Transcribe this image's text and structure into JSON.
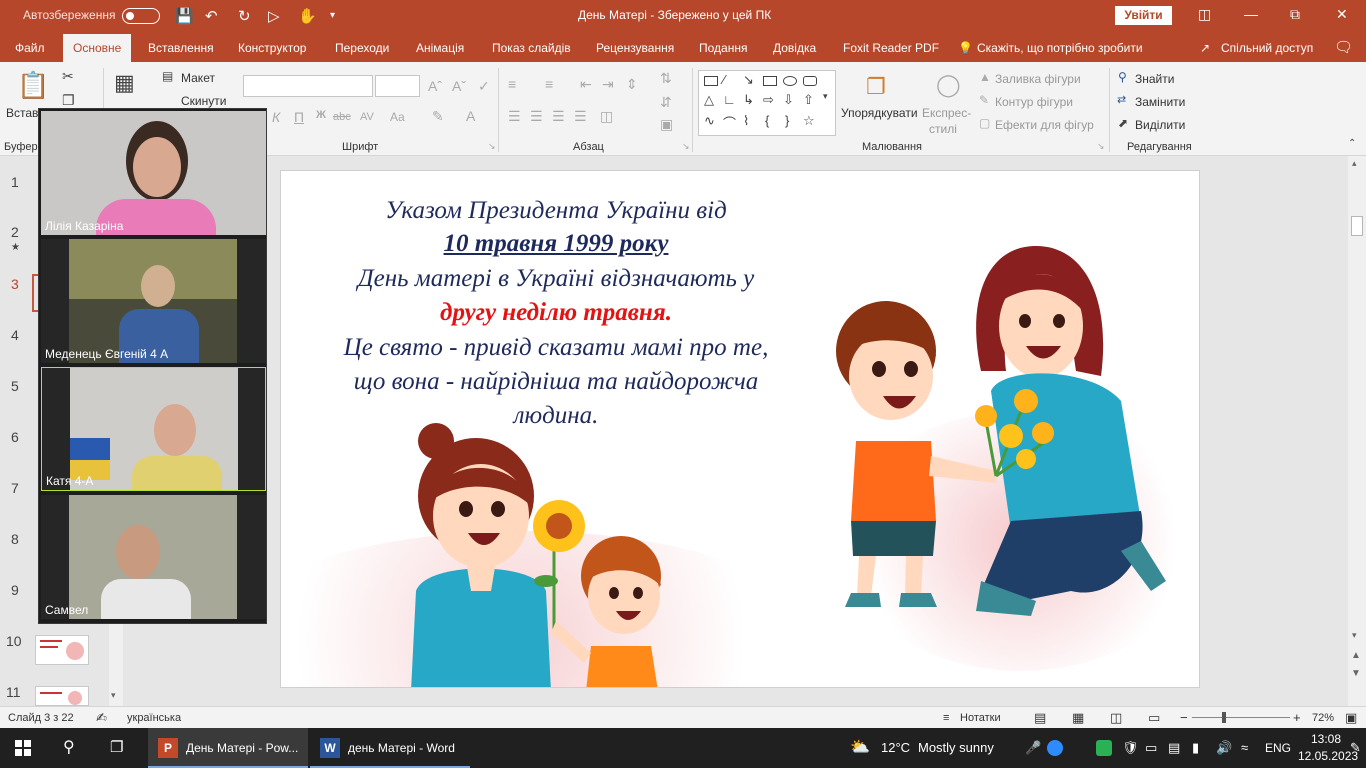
{
  "titlebar": {
    "autosave": "Автозбереження",
    "title": "День Матері  -  Збережено у цей ПК",
    "signin": "Увійти"
  },
  "menu": [
    "Файл",
    "Основне",
    "Вставлення",
    "Конструктор",
    "Переходи",
    "Анімація",
    "Показ слайдів",
    "Рецензування",
    "Подання",
    "Довідка",
    "Foxit Reader PDF"
  ],
  "tell_me": "Скажіть, що потрібно зробити",
  "share": "Спільний доступ",
  "ribbon": {
    "paste": "Встав",
    "layout": "Макет",
    "reset": "Скинути",
    "bold": "Ж",
    "italic": "К",
    "underline": "П",
    "strike": "abc",
    "spacing": "AV",
    "case": "Aa",
    "arrange": "Упорядкувати",
    "quick1": "Експрес-",
    "quick2": "стилі",
    "fill": "Заливка фігури",
    "outline": "Контур фігури",
    "effects": "Ефекти для фігур",
    "find": "Знайти",
    "replace": "Замінити",
    "select": "Виділити",
    "groups": {
      "clip": "Буфер",
      "font": "Шрифт",
      "para": "Абзац",
      "draw": "Малювання",
      "edit": "Редагування"
    }
  },
  "slide_numbers": [
    "1",
    "2",
    "3",
    "4",
    "5",
    "6",
    "7",
    "8",
    "9",
    "10",
    "11"
  ],
  "slide_star": "★",
  "slide": {
    "line1": "Указом Президента України від",
    "line2": "10 травня 1999 року",
    "line3": "День матері в Україні відзначають у",
    "line4": "другу неділю травня.",
    "line5": "Це свято - привід сказати мамі про те,",
    "line6": "що вона - найрідніша та найдорожча",
    "line7": "людина."
  },
  "participants": [
    "Лілія Казаріна",
    "Меденець Євгеній 4 А",
    "Катя  4-А",
    "Самвел"
  ],
  "status": {
    "slide": "Слайд 3 з 22",
    "lang": "українська",
    "notes": "Нотатки",
    "zoom": "72%"
  },
  "taskbar": {
    "ppt": "День Матері - Pow...",
    "word": "день Матері - Word",
    "temp": "12°C",
    "weather": "Mostly sunny",
    "lang": "ENG",
    "time": "13:08",
    "date": "12.05.2023"
  },
  "colors": {
    "accent": "#b7472a",
    "slide_text": "#1f2a5c",
    "highlight": "#e41212",
    "active_speaker": "#b4e12b"
  }
}
